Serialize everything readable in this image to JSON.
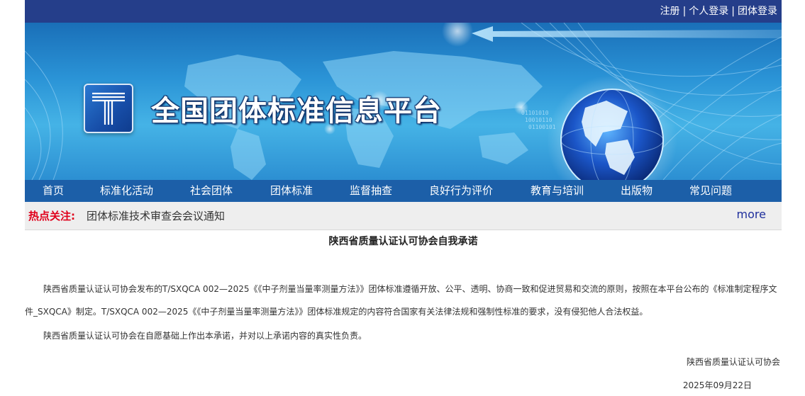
{
  "top_links": {
    "register": "注册",
    "personal_login": "个人登录",
    "group_login": "团体登录",
    "separator": "|"
  },
  "banner": {
    "title": "全国团体标准信息平台"
  },
  "nav": {
    "items": [
      "首页",
      "标准化活动",
      "社会团体",
      "团体标准",
      "监督抽查",
      "良好行为评价",
      "教育与培训",
      "出版物",
      "常见问题"
    ]
  },
  "hot": {
    "label": "热点关注:",
    "link": "团体标准技术审查会会议通知",
    "more": "more"
  },
  "article": {
    "title": "陕西省质量认证认可协会自我承诺",
    "para1": "陕西省质量认证认可协会发布的T/SXQCA 002—2025《《中子剂量当量率测量方法》》团体标准遵循开放、公平、透明、协商一致和促进贸易和交流的原则，按照在本平台公布的《标准制定程序文件_SXQCA》制定。T/SXQCA 002—2025《《中子剂量当量率测量方法》》团体标准规定的内容符合国家有关法律法规和强制性标准的要求，没有侵犯他人合法权益。",
    "para2": "陕西省质量认证认可协会在自愿基础上作出本承诺，并对以上承诺内容的真实性负责。",
    "signer": "陕西省质量认证认可协会",
    "date": "2025年09月22日"
  },
  "colors": {
    "topbar": "#253e8a",
    "nav": "#1c5fa8",
    "hot_label": "#e0001b",
    "more_link": "#1f2f9c"
  }
}
